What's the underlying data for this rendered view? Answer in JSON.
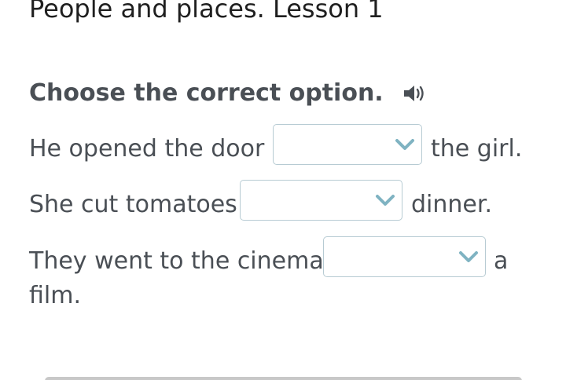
{
  "header": {
    "title": "People and places. Lesson 1"
  },
  "exercise": {
    "instruction": "Choose the correct option.",
    "audio_icon": "speaker-icon",
    "sentences": [
      {
        "before": "He opened the door",
        "selected": "",
        "after": "the girl."
      },
      {
        "before": "She cut tomatoes",
        "selected": "",
        "after": "dinner."
      },
      {
        "before": "They went to the cinema",
        "selected": "",
        "after": "a",
        "continuation": "film."
      }
    ]
  },
  "colors": {
    "text": "#4a4f55",
    "title": "#1f1f1f",
    "dropdown_border": "#b7cbd3",
    "chevron": "#7fb3c2"
  }
}
